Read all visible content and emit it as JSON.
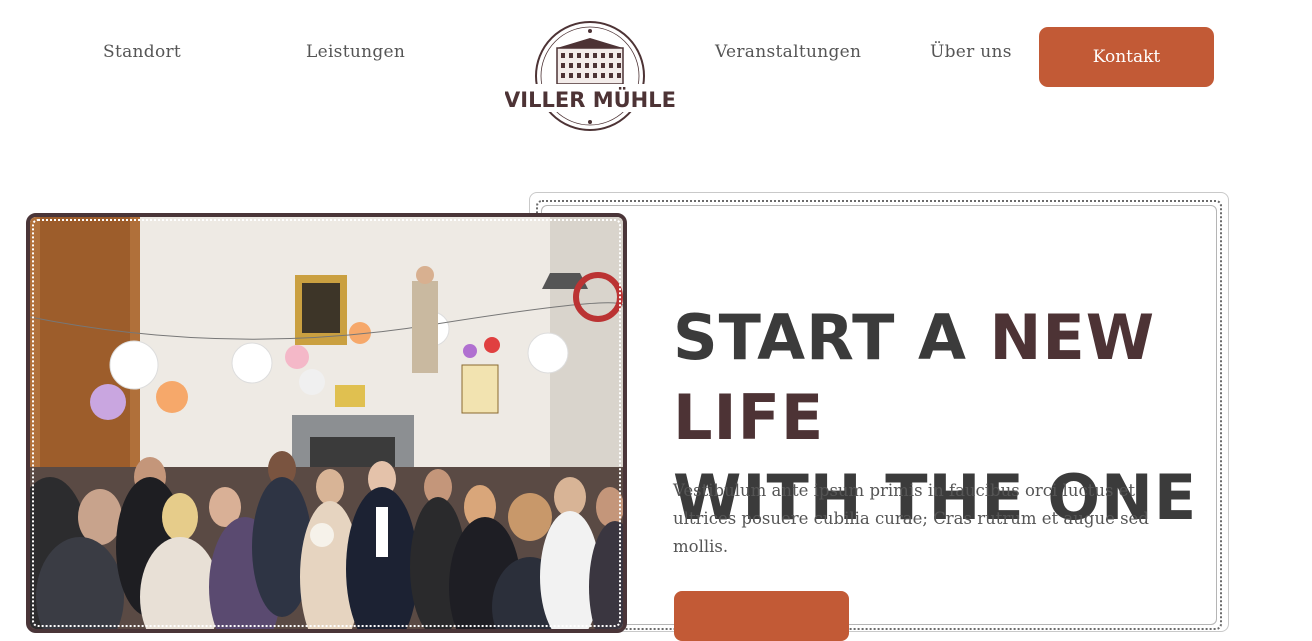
{
  "nav": {
    "standort": "Standort",
    "leistungen": "Leistungen",
    "veranstaltungen": "Veranstaltungen",
    "ueber_uns": "Über uns",
    "kontakt": "Kontakt"
  },
  "logo": {
    "text": "VILLER MÜHLE"
  },
  "hero": {
    "headline_part1": "START A ",
    "headline_accent": "NEW LIFE",
    "headline_part2": "WITH THE ONE",
    "body": "Vestibulum ante ipsum primis in faucibus orci luctus et ultrices posuere cubilia curae; Cras rutrum et augue sed mollis."
  },
  "colors": {
    "accent": "#c25a36",
    "brand_dark": "#4d3335",
    "text": "#3b3b3b"
  }
}
